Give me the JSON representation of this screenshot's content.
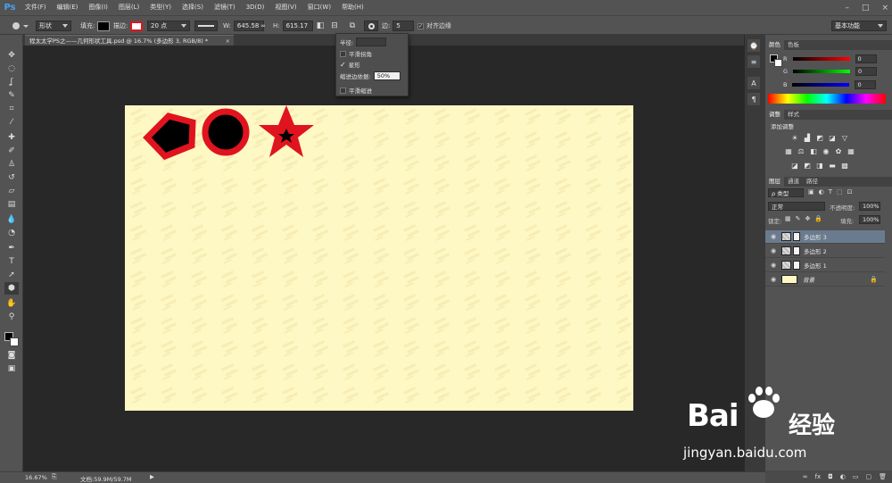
{
  "app": {
    "logo": "Ps"
  },
  "menu": [
    "文件(F)",
    "编辑(E)",
    "图像(I)",
    "图层(L)",
    "类型(Y)",
    "选择(S)",
    "滤镜(T)",
    "3D(D)",
    "视图(V)",
    "窗口(W)",
    "帮助(H)"
  ],
  "window_controls": {
    "minimize": "–",
    "restore": "□",
    "close": "×"
  },
  "options": {
    "mode": "形状",
    "fill_label": "填充:",
    "stroke_label": "描边:",
    "stroke_size": "20 点",
    "w_label": "W:",
    "w_value": "645.58",
    "link_glyph": "∞",
    "h_label": "H:",
    "h_value": "615.17",
    "sides_label": "边:",
    "sides_value": "5",
    "align_edges_label": "对齐边缘",
    "workspace": "基本功能",
    "fill_color": "#000000",
    "stroke_color": "#e0141e"
  },
  "polygon_popup": {
    "radius_label": "半径:",
    "radius_value": "",
    "smooth_corners": "平滑拐角",
    "star": "星形",
    "indent_label": "缩进边依据:",
    "indent_value": "50%",
    "smooth_indents": "平滑缩进",
    "smooth_corners_checked": false,
    "star_checked": true,
    "smooth_indents_checked": false
  },
  "document": {
    "tab_title": "程太太学PS之——几何形状工具.psd @ 16.7% (多边形 3, RGB/8) *",
    "close": "×",
    "canvas_color": "#fdf8c4",
    "shape_fill": "#000000",
    "shape_stroke": "#e0141e"
  },
  "panels": {
    "color_tabs": [
      "颜色",
      "色板"
    ],
    "rgb": [
      {
        "label": "R",
        "value": "0"
      },
      {
        "label": "G",
        "value": "0"
      },
      {
        "label": "B",
        "value": "0"
      }
    ],
    "adjust_tabs": [
      "调整",
      "样式"
    ],
    "add_adjustment": "添加调整",
    "layer_tabs": [
      "图层",
      "通道",
      "路径"
    ],
    "filter_kind": "ρ 类型",
    "blend_mode": "正常",
    "opacity_label": "不透明度:",
    "opacity_value": "100%",
    "lock_label": "锁定:",
    "fill_label": "填充:",
    "fill_value": "100%",
    "layers": [
      {
        "name": "多边形 3",
        "selected": true
      },
      {
        "name": "多边形 2",
        "selected": false
      },
      {
        "name": "多边形 1",
        "selected": false
      },
      {
        "name": "背景",
        "selected": false,
        "is_background": true
      }
    ]
  },
  "status": {
    "zoom": "16.67%",
    "doc_size": "文档:59.9M/59.7M"
  },
  "watermark": {
    "brand": "Bai",
    "brand_cn": "经验",
    "url": "jingyan.baidu.com"
  }
}
